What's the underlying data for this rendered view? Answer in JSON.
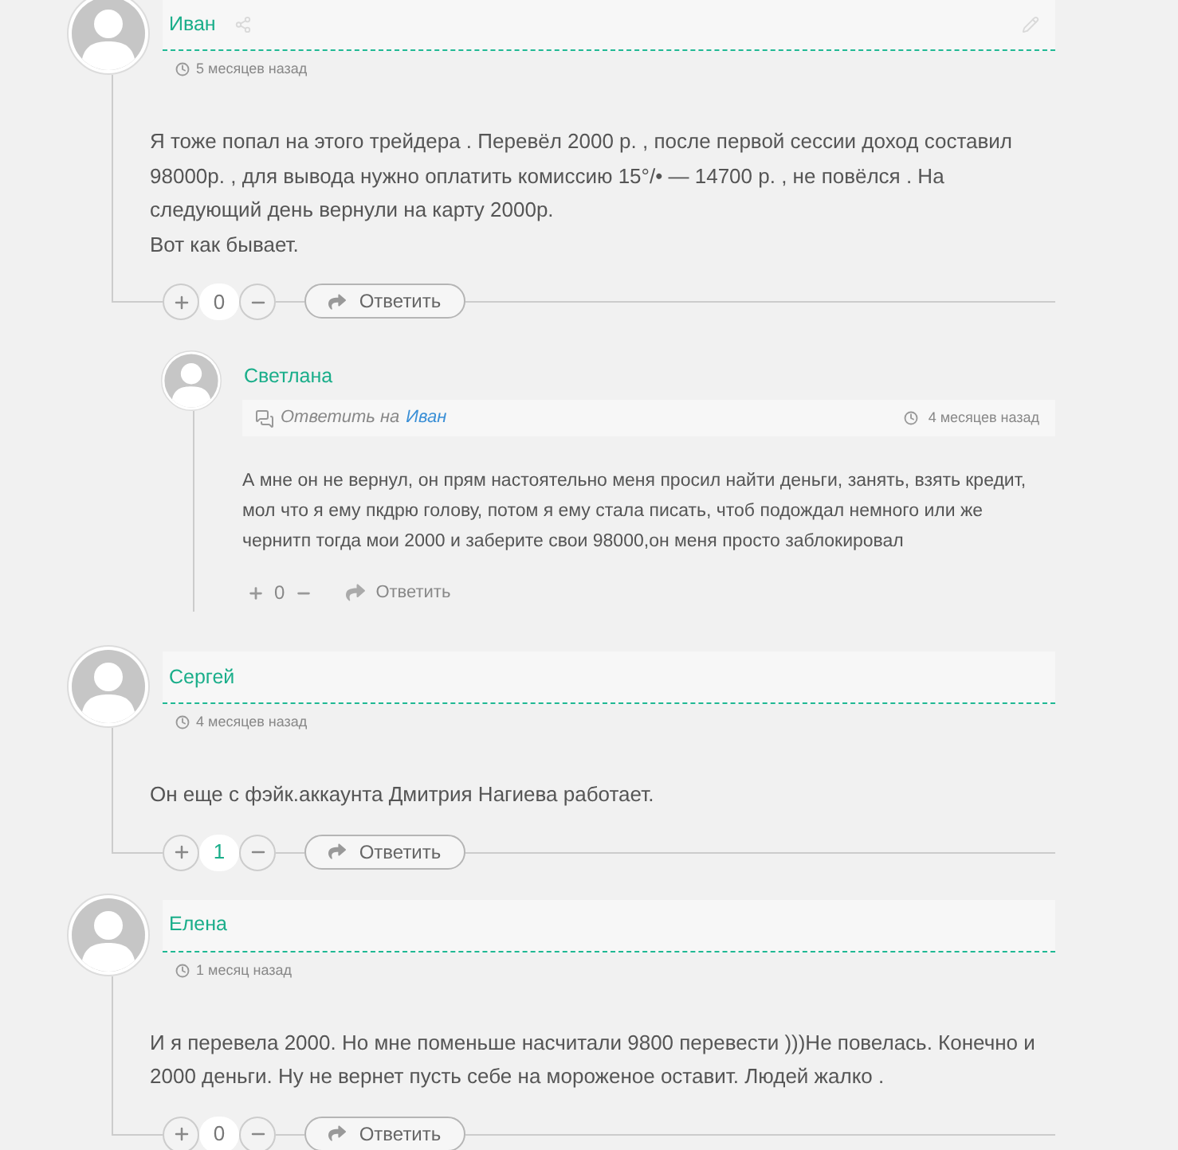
{
  "comments": [
    {
      "author": "Иван",
      "time": "5 месяцев назад",
      "tools_shown": true,
      "body": [
        "Я тоже попал на этого трейдера . Перевёл 2000 р. , после первой сессии доход составил 98000р. , для вывода нужно оплатить комиссию 15°/• — 14700 р. , не повёлся . На следующий день вернули на карту 2000р.",
        "Вот как бывает."
      ],
      "votes": {
        "count": "0",
        "positive": false
      },
      "reply_label": "Ответить",
      "replies": [
        {
          "author": "Светлана",
          "reply_to_label": "Ответить на",
          "reply_to": "Иван",
          "time": "4 месяцев назад",
          "body": [
            "А мне он не вернул, он прям настоятельно меня просил найти деньги, занять, взять кредит, мол что я ему пкдрю голову, потом я ему стала писать, чтоб подождал немного или же чернитп тогда мои 2000 и заберите свои 98000,он меня просто заблокировал"
          ],
          "votes": {
            "count": "0",
            "positive": false
          },
          "reply_label": "Ответить"
        }
      ]
    },
    {
      "author": "Сергей",
      "time": "4 месяцев назад",
      "tools_shown": false,
      "body": [
        "Он еще с фэйк.аккаунта Дмитрия Нагиева работает."
      ],
      "votes": {
        "count": "1",
        "positive": true
      },
      "reply_label": "Ответить"
    },
    {
      "author": "Елена",
      "time": "1 месяц назад",
      "tools_shown": false,
      "body": [
        "И я перевела 2000. Но мне поменьше насчитали 9800 перевести )))Не повелась. Конечно и 2000 деньги. Ну не вернет пусть себе на мороженое оставит. Людей жалко ."
      ],
      "votes": {
        "count": "0",
        "positive": false
      },
      "reply_label": "Ответить"
    }
  ]
}
